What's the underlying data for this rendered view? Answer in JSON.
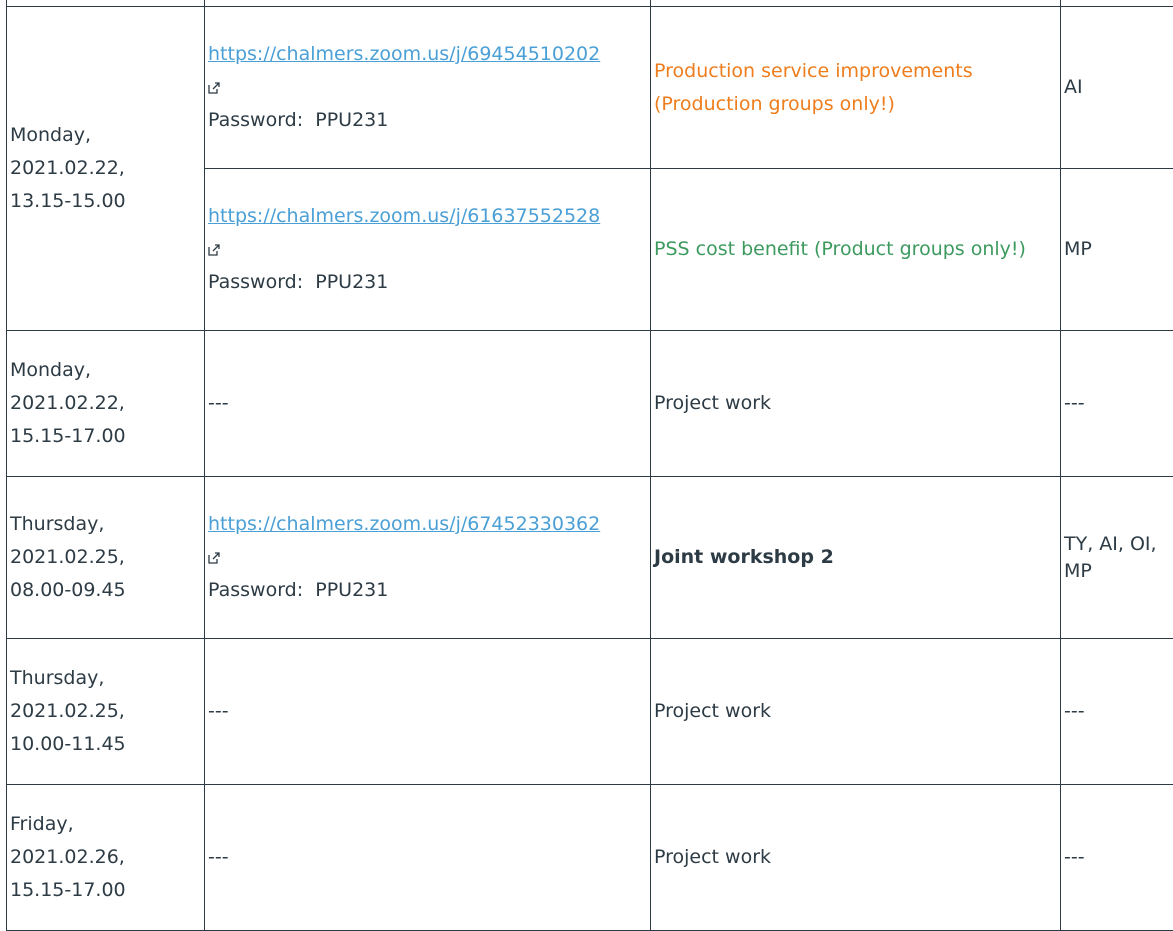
{
  "schedule": {
    "rows": [
      {
        "date": [
          "Monday,",
          "2021.02.22,",
          "13.15-15.00"
        ],
        "sessions": [
          {
            "link": "https://chalmers.zoom.us/j/69454510202",
            "password_label": "Password:",
            "password": "PPU231",
            "topic": [
              "Production service improvements",
              "(Production groups only!)"
            ],
            "topic_color": "#ee7d1d",
            "lead": "AI"
          },
          {
            "link": "https://chalmers.zoom.us/j/61637552528",
            "password_label": "Password:",
            "password": "PPU231",
            "topic": [
              "PSS cost benefit (Product groups only!)"
            ],
            "topic_color": "#3d9a5e",
            "lead": "MP"
          }
        ]
      },
      {
        "date": [
          "Monday,",
          "2021.02.22,",
          "15.15-17.00"
        ],
        "link_text": "---",
        "topic": "Project work",
        "lead": "---"
      },
      {
        "date": [
          "Thursday,",
          "2021.02.25,",
          "08.00-09.45"
        ],
        "link": "https://chalmers.zoom.us/j/67452330362",
        "password_label": "Password:",
        "password": "PPU231",
        "topic": "Joint workshop 2",
        "lead": [
          "TY, AI, OI,",
          "MP"
        ]
      },
      {
        "date": [
          "Thursday,",
          "2021.02.25,",
          "10.00-11.45"
        ],
        "link_text": "---",
        "topic": "Project work",
        "lead": "---"
      },
      {
        "date": [
          "Friday,",
          "2021.02.26,",
          "15.15-17.00"
        ],
        "link_text": "---",
        "topic": "Project work",
        "lead": "---"
      }
    ]
  }
}
